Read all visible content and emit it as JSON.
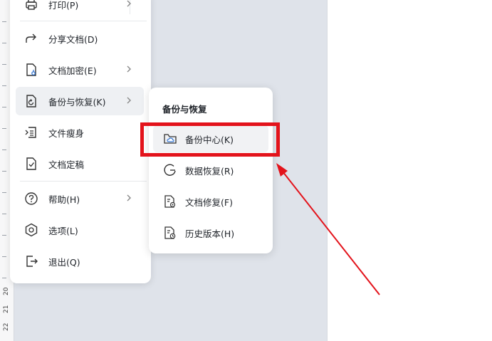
{
  "ruler": {
    "numbers": [
      "20",
      "21",
      "22"
    ]
  },
  "menu": {
    "items": [
      {
        "label": "打印(P)"
      },
      {
        "label": "分享文档(D)"
      },
      {
        "label": "文档加密(E)"
      },
      {
        "label": "备份与恢复(K)"
      },
      {
        "label": "文件瘦身"
      },
      {
        "label": "文档定稿"
      },
      {
        "label": "帮助(H)"
      },
      {
        "label": "选项(L)"
      },
      {
        "label": "退出(Q)"
      }
    ]
  },
  "submenu": {
    "title": "备份与恢复",
    "items": [
      {
        "label": "备份中心(K)"
      },
      {
        "label": "数据恢复(R)"
      },
      {
        "label": "文档修复(F)"
      },
      {
        "label": "历史版本(H)"
      }
    ]
  },
  "colors": {
    "highlight": "#e3131b",
    "accent": "#3a7bd5"
  }
}
